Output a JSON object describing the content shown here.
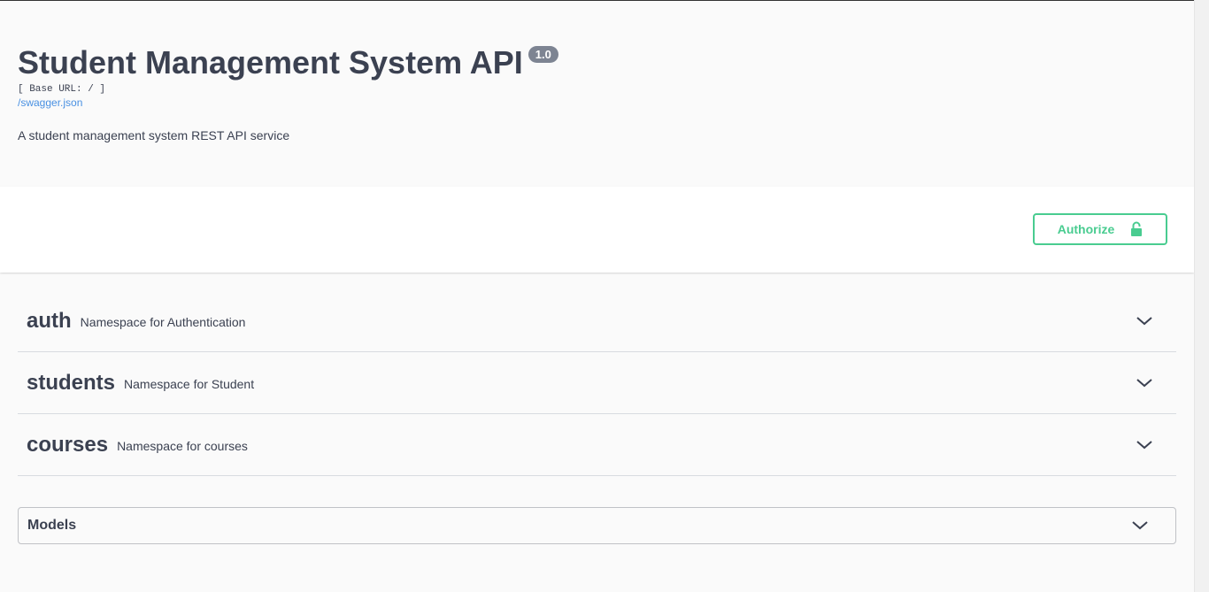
{
  "info": {
    "title": "Student Management System API",
    "version": "1.0",
    "base_url": "[ Base URL: / ]",
    "spec_link": "/swagger.json",
    "description": "A student management system REST API service"
  },
  "authorize": {
    "label": "Authorize",
    "icon": "unlocked-lock-icon",
    "color": "#49cc90"
  },
  "tags": [
    {
      "name": "auth",
      "description": "Namespace for Authentication"
    },
    {
      "name": "students",
      "description": "Namespace for Student"
    },
    {
      "name": "courses",
      "description": "Namespace for courses"
    }
  ],
  "models": {
    "title": "Models"
  },
  "colors": {
    "text": "#3b4151",
    "link": "#4990e2",
    "version_badge": "#7d8492"
  }
}
